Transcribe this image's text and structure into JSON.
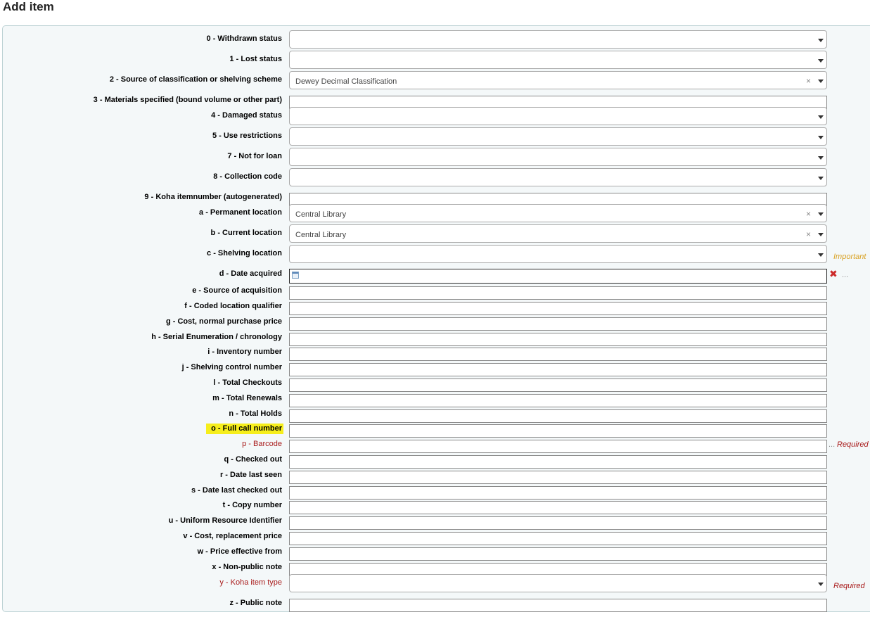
{
  "page": {
    "title": "Add item"
  },
  "fields": {
    "f0": {
      "label": "0 - Withdrawn status",
      "value": ""
    },
    "f1": {
      "label": "1 - Lost status",
      "value": ""
    },
    "f2": {
      "label": "2 - Source of classification or shelving scheme",
      "value": "Dewey Decimal Classification"
    },
    "f3": {
      "label": "3 - Materials specified (bound volume or other part)",
      "value": ""
    },
    "f4": {
      "label": "4 - Damaged status",
      "value": ""
    },
    "f5": {
      "label": "5 - Use restrictions",
      "value": ""
    },
    "f7": {
      "label": "7 - Not for loan",
      "value": ""
    },
    "f8": {
      "label": "8 - Collection code",
      "value": ""
    },
    "f9": {
      "label": "9 - Koha itemnumber (autogenerated)",
      "value": ""
    },
    "fa": {
      "label": "a - Permanent location",
      "value": "Central Library"
    },
    "fb": {
      "label": "b - Current location",
      "value": "Central Library"
    },
    "fc": {
      "label": "c - Shelving location",
      "value": "",
      "note": "Important"
    },
    "fd": {
      "label": "d - Date acquired",
      "value": ""
    },
    "fe": {
      "label": "e - Source of acquisition",
      "value": ""
    },
    "ff": {
      "label": "f - Coded location qualifier",
      "value": ""
    },
    "fg": {
      "label": "g - Cost, normal purchase price",
      "value": ""
    },
    "fh": {
      "label": "h - Serial Enumeration / chronology",
      "value": ""
    },
    "fi": {
      "label": "i - Inventory number",
      "value": ""
    },
    "fj": {
      "label": "j - Shelving control number",
      "value": ""
    },
    "fl": {
      "label": "l - Total Checkouts",
      "value": ""
    },
    "fm": {
      "label": "m - Total Renewals",
      "value": ""
    },
    "fn": {
      "label": "n - Total Holds",
      "value": ""
    },
    "fo": {
      "label": "o - Full call number",
      "value": ""
    },
    "fp": {
      "label": "p - Barcode",
      "value": "",
      "note": "Required"
    },
    "fq": {
      "label": "q - Checked out",
      "value": ""
    },
    "fr": {
      "label": "r - Date last seen",
      "value": ""
    },
    "fs": {
      "label": "s - Date last checked out",
      "value": ""
    },
    "ft": {
      "label": "t - Copy number",
      "value": ""
    },
    "fu": {
      "label": "u - Uniform Resource Identifier",
      "value": ""
    },
    "fv": {
      "label": "v - Cost, replacement price",
      "value": ""
    },
    "fw": {
      "label": "w - Price effective from",
      "value": ""
    },
    "fx": {
      "label": "x - Non-public note",
      "value": ""
    },
    "fy": {
      "label": "y - Koha item type",
      "value": "",
      "note": "Required"
    },
    "fz": {
      "label": "z - Public note",
      "value": ""
    }
  },
  "icons": {
    "clear": "×",
    "delete": "✖",
    "more": "..."
  },
  "colors": {
    "required": "#a81a1a",
    "important": "#d9a224",
    "highlight": "#f6ee1c",
    "panel_bg": "#f4f8f9"
  }
}
